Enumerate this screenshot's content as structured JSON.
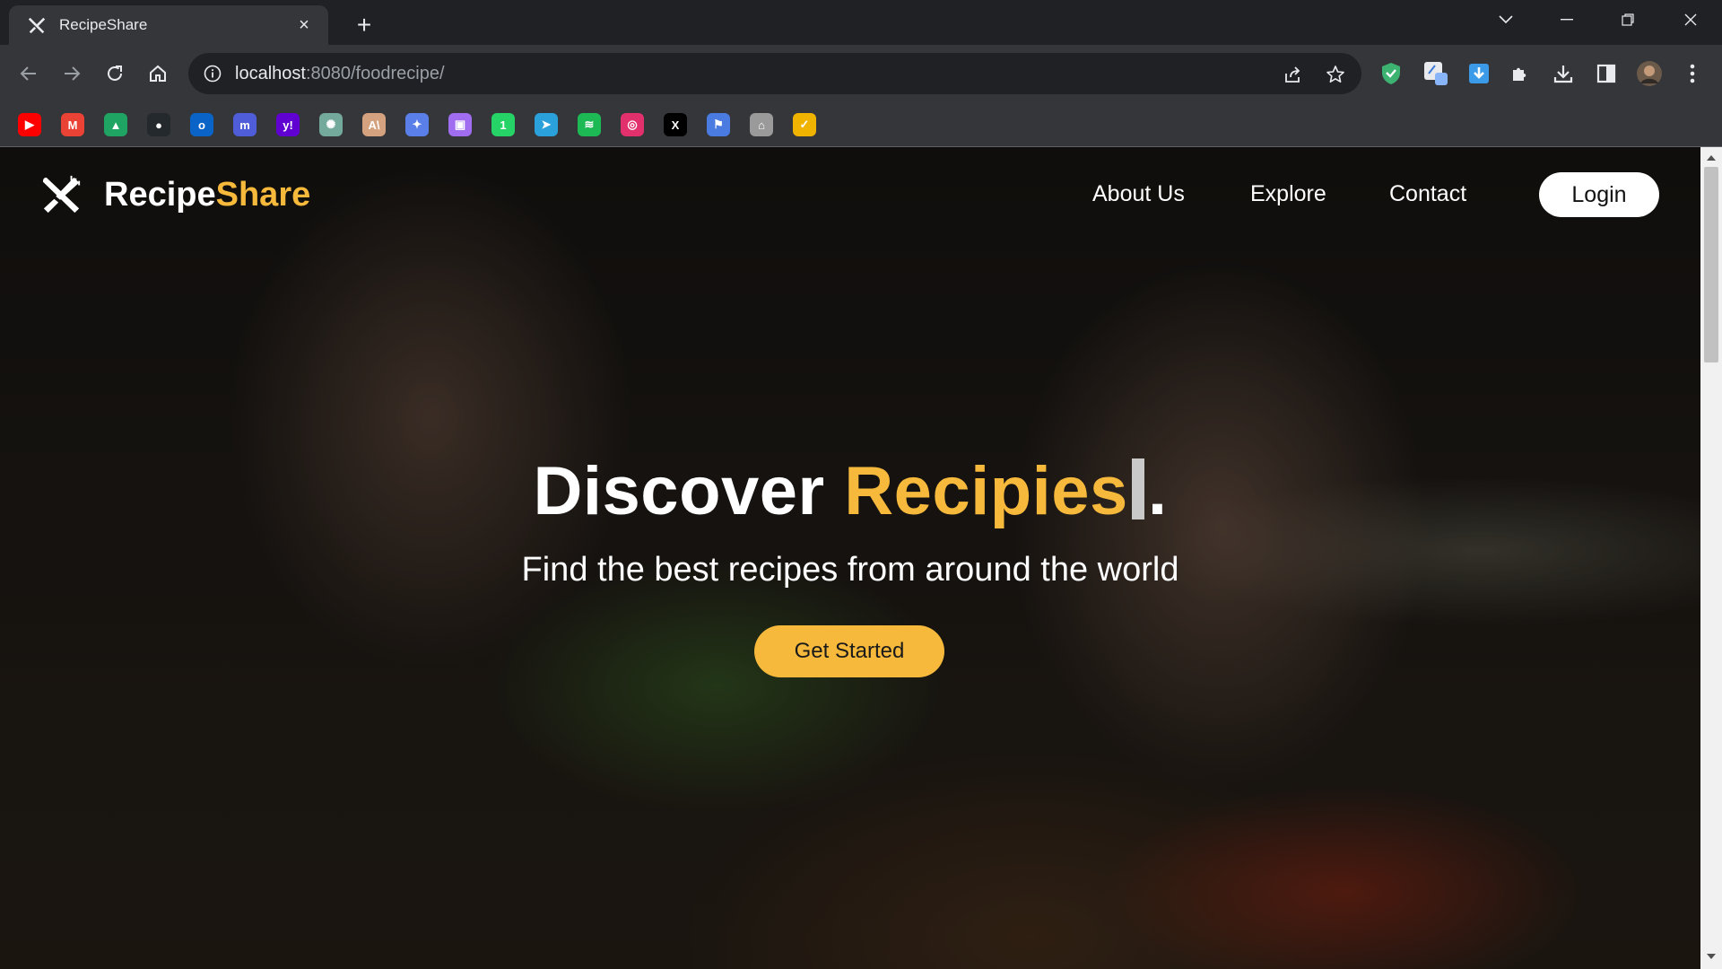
{
  "browser": {
    "tab_title": "RecipeShare",
    "url_host": "localhost",
    "url_path": ":8080/foodrecipe/",
    "bookmarks": [
      {
        "name": "youtube-icon",
        "glyph": "▶",
        "color": "#ff0000"
      },
      {
        "name": "gmail-icon",
        "glyph": "M",
        "color": "#ea4335"
      },
      {
        "name": "google-drive-icon",
        "glyph": "▲",
        "color": "#1fa463"
      },
      {
        "name": "github-icon",
        "glyph": "●",
        "color": "#24292e"
      },
      {
        "name": "outlook-icon",
        "glyph": "o",
        "color": "#0a64c8"
      },
      {
        "name": "mastodon-icon",
        "glyph": "m",
        "color": "#4f5dd8"
      },
      {
        "name": "yahoo-icon",
        "glyph": "y!",
        "color": "#6001d2"
      },
      {
        "name": "chatgpt-icon",
        "glyph": "✺",
        "color": "#74aa9c"
      },
      {
        "name": "anthropic-icon",
        "glyph": "A\\",
        "color": "#d4a27f"
      },
      {
        "name": "gemini-icon",
        "glyph": "✦",
        "color": "#5b7fe8"
      },
      {
        "name": "app-icon",
        "glyph": "▣",
        "color": "#a06cf0"
      },
      {
        "name": "whatsapp-icon",
        "glyph": "1",
        "color": "#25d366"
      },
      {
        "name": "telegram-icon",
        "glyph": "➤",
        "color": "#2aa1da"
      },
      {
        "name": "spotify-icon",
        "glyph": "≋",
        "color": "#1db954"
      },
      {
        "name": "instagram-icon",
        "glyph": "◎",
        "color": "#e1306c"
      },
      {
        "name": "x-icon",
        "glyph": "X",
        "color": "#000000"
      },
      {
        "name": "flag-icon",
        "glyph": "⚑",
        "color": "#4a7be0"
      },
      {
        "name": "tool-icon",
        "glyph": "⌂",
        "color": "#9a9a9a"
      },
      {
        "name": "check-icon",
        "glyph": "✓",
        "color": "#f0b400"
      }
    ]
  },
  "site": {
    "logo_part1": "Recipe",
    "logo_part2": "Share",
    "nav": {
      "about": "About Us",
      "explore": "Explore",
      "contact": "Contact",
      "login": "Login"
    },
    "hero": {
      "headline_white": "Discover ",
      "headline_accent": "Recipies",
      "headline_end": ".",
      "subheading": "Find the best recipes from around the world",
      "cta": "Get Started"
    }
  },
  "colors": {
    "accent": "#f6b93b",
    "chrome_dark": "#202124",
    "chrome_mid": "#35363a"
  }
}
